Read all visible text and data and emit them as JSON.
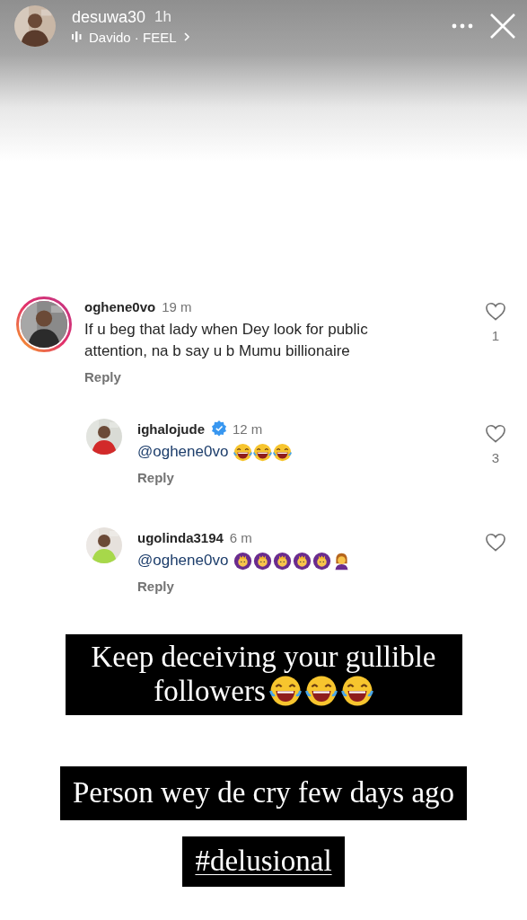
{
  "story_header": {
    "username": "desuwa30",
    "time": "1h",
    "music": "Davido · FEEL"
  },
  "comments": [
    {
      "username": "oghene0vo",
      "verified": false,
      "time": "19 m",
      "text": "If u beg that lady when Dey look for public attention, na b say u b Mumu billionaire",
      "reply": "Reply",
      "likes": "1",
      "kind": "comment",
      "story_ring": true
    },
    {
      "username": "ighalojude",
      "verified": true,
      "time": "12 m",
      "text": "@oghene0vo",
      "reactions": [
        {
          "kind": "laughing"
        },
        {
          "kind": "laughing"
        },
        {
          "kind": "laughing"
        }
      ],
      "reply": "Reply",
      "likes": "3",
      "kind": "reply",
      "story_ring": false
    },
    {
      "username": "ugolinda3194",
      "verified": false,
      "time": "6 m",
      "text": "@oghene0vo",
      "reactions": [
        {
          "kind": "crown"
        },
        {
          "kind": "crown"
        },
        {
          "kind": "crown"
        },
        {
          "kind": "crown"
        },
        {
          "kind": "crown"
        },
        {
          "kind": "woman"
        }
      ],
      "reply": "Reply",
      "kind": "reply",
      "story_ring": false
    }
  ],
  "captions": [
    {
      "lines": [
        "Keep deceiving your gullible",
        "followers"
      ],
      "reactions": [
        {
          "kind": "laughing"
        },
        {
          "kind": "laughing"
        },
        {
          "kind": "laughing"
        }
      ],
      "kind": "plain"
    },
    {
      "lines": [
        "Person wey de cry few days ago"
      ],
      "kind": "plain"
    },
    {
      "lines": [
        "#delusional"
      ],
      "kind": "hashtag"
    }
  ]
}
